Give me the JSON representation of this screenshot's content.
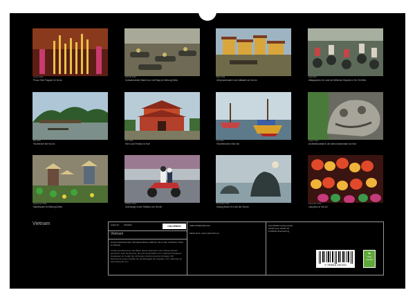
{
  "calendar": {
    "title": "Vietnam",
    "months": [
      {
        "month": "Januar 2024",
        "caption": "Phuoc Kien Pagode in Hoi An",
        "scene": "incense"
      },
      {
        "month": "Februar 2024",
        "caption": "Schwimmender Markt von Cai Rang im Mekong Delta",
        "scene": "market"
      },
      {
        "month": "März 2024",
        "caption": "Uferpromenade in der Altstadt von Hoi An",
        "scene": "riverfront"
      },
      {
        "month": "April 2024",
        "caption": "Alltagsszene im Land der Millionen Mopeds in Ho Chi Minh",
        "scene": "mopeds"
      },
      {
        "month": "Mai 2024",
        "caption": "Fischerdorf bei Hoi An",
        "scene": "village"
      },
      {
        "month": "Juni 2024",
        "caption": "Hien Lam Pavillon in Hue",
        "scene": "pavilion"
      },
      {
        "month": "Juli 2024",
        "caption": "Fischerboote in Mui Ne",
        "scene": "boats"
      },
      {
        "month": "August 2024",
        "caption": "Architekturdetail in der alten Kaiserstadt von Hue",
        "scene": "dragon"
      },
      {
        "month": "September 2024",
        "caption": "Marktfrauen im Mekong Delta",
        "scene": "marketwomen"
      },
      {
        "month": "Oktober 2024",
        "caption": "Unterwegs in den Straßen von Hoi An",
        "scene": "scooter"
      },
      {
        "month": "November 2024",
        "caption": "Halong Bucht im Licht der Sonne",
        "scene": "halong"
      },
      {
        "month": "Dezember 2024",
        "caption": "Lampions in Hoi An",
        "scene": "lanterns"
      }
    ]
  },
  "info": {
    "product_title": "Vietnam",
    "article_label": "Artikel Nr.",
    "article_no": "2033392",
    "publisher_logo": "CALVENDO",
    "description": "Unsere faszinierenden Schnappschüsse entführen Sie zu den schönsten Orten in Vietnam.",
    "legal": "Urheberrechtshinweis: Alle Bilder dieses Kalenders sind urheberrechtlich geschützt. Jede Verwertung, die nicht ausdrücklich vom Urheberrechtsgesetz zugelassen ist, bedarf der vorherigen Zustimmung des Verlages. Wir übernehmen keine Gewähr für die Richtigkeit der Angaben. Info: calvendo.de, www.calvendo.com",
    "isbn": "ISBN 9783816187243",
    "photographer": "Martin Roth, www.martinroth.net",
    "publisher_name": "CALVENDO Verlag GmbH",
    "publisher_street": "Ottobrunner Straße 39",
    "publisher_city": "D-82008 Unterhaching",
    "barcode_number": "9 783816 187243",
    "eco_label": "CO2 neutral"
  },
  "colors": {
    "background": "#000000",
    "text": "#bdbdbd",
    "border": "#9a9a9a"
  }
}
